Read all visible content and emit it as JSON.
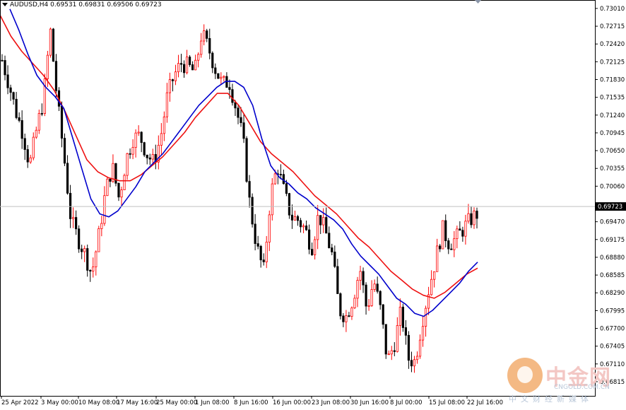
{
  "header": {
    "symbol": "AUDUSD,H4",
    "open": "0.69531",
    "high": "0.69831",
    "low": "0.69506",
    "close": "0.69723"
  },
  "watermark": {
    "brand": "中金网",
    "site": "CNGOLD.COM.CN",
    "tagline": "中文财经新媒体",
    "logo_color": "#f0a25b"
  },
  "colors": {
    "bull": "#ff0000",
    "bear": "#000000",
    "ma_fast": "#0000cc",
    "ma_slow": "#ee1111",
    "current_price_bg": "#000000"
  },
  "chart_data": {
    "type": "line",
    "title": "AUDUSD,H4",
    "ylim": [
      0.6658,
      0.7315
    ],
    "y_ticks": [
      "0.73010",
      "0.72715",
      "0.72420",
      "0.72125",
      "0.71830",
      "0.71535",
      "0.71240",
      "0.70945",
      "0.70650",
      "0.70355",
      "0.70060",
      "0.69470",
      "0.69175",
      "0.68880",
      "0.68585",
      "0.68290",
      "0.67995",
      "0.67700",
      "0.67405",
      "0.67110",
      "0.66815"
    ],
    "current_price_label": "0.69723",
    "current_price": 0.69723,
    "x_ticks": [
      "25 Apr 2022",
      "3 May 00:00",
      "10 May 08:00",
      "17 May 16:00",
      "25 May 00:00",
      "1 Jun 08:00",
      "8 Jun 16:00",
      "16 Jun 00:00",
      "23 Jun 08:00",
      "30 Jun 16:00",
      "8 Jul 00:00",
      "15 Jul 08:00",
      "22 Jul 16:00"
    ],
    "price_path": [
      0.7215,
      0.7175,
      0.713,
      0.7095,
      0.704,
      0.71,
      0.715,
      0.7265,
      0.715,
      0.7055,
      0.695,
      0.692,
      0.6895,
      0.686,
      0.692,
      0.6995,
      0.704,
      0.6985,
      0.705,
      0.7085,
      0.709,
      0.706,
      0.7045,
      0.7085,
      0.7155,
      0.719,
      0.721,
      0.7205,
      0.7195,
      0.726,
      0.7235,
      0.72,
      0.7175,
      0.718,
      0.7135,
      0.7085,
      0.6975,
      0.6905,
      0.6865,
      0.699,
      0.704,
      0.6995,
      0.6955,
      0.695,
      0.6935,
      0.6905,
      0.696,
      0.693,
      0.689,
      0.68,
      0.679,
      0.682,
      0.687,
      0.68,
      0.685,
      0.68,
      0.6715,
      0.6745,
      0.68,
      0.672,
      0.6715,
      0.678,
      0.6835,
      0.6885,
      0.6935,
      0.691,
      0.692,
      0.6935,
      0.695,
      0.696
    ],
    "series": [
      {
        "name": "",
        "kind": "ma-fast",
        "color": "#0000cc",
        "values": [
          0.73,
          0.7265,
          0.7225,
          0.719,
          0.717,
          0.7155,
          0.7135,
          0.7085,
          0.7035,
          0.6985,
          0.696,
          0.6955,
          0.6965,
          0.6985,
          0.7005,
          0.703,
          0.7045,
          0.706,
          0.708,
          0.71,
          0.712,
          0.714,
          0.7155,
          0.717,
          0.718,
          0.718,
          0.717,
          0.714,
          0.7085,
          0.704,
          0.702,
          0.701,
          0.6995,
          0.6985,
          0.697,
          0.696,
          0.695,
          0.6935,
          0.691,
          0.689,
          0.6875,
          0.686,
          0.684,
          0.682,
          0.681,
          0.6795,
          0.679,
          0.68,
          0.6815,
          0.683,
          0.6845,
          0.6865,
          0.688
        ]
      },
      {
        "name": "",
        "kind": "ma-slow",
        "color": "#ee1111",
        "values": [
          0.729,
          0.7255,
          0.723,
          0.721,
          0.719,
          0.7165,
          0.713,
          0.709,
          0.705,
          0.703,
          0.702,
          0.7015,
          0.7015,
          0.7025,
          0.704,
          0.7055,
          0.7075,
          0.7095,
          0.712,
          0.714,
          0.716,
          0.716,
          0.714,
          0.711,
          0.708,
          0.706,
          0.7045,
          0.703,
          0.701,
          0.699,
          0.6975,
          0.696,
          0.694,
          0.692,
          0.6905,
          0.6885,
          0.6865,
          0.685,
          0.6835,
          0.6825,
          0.682,
          0.683,
          0.6845,
          0.686,
          0.687
        ]
      }
    ],
    "grid": false,
    "legend": "none"
  }
}
